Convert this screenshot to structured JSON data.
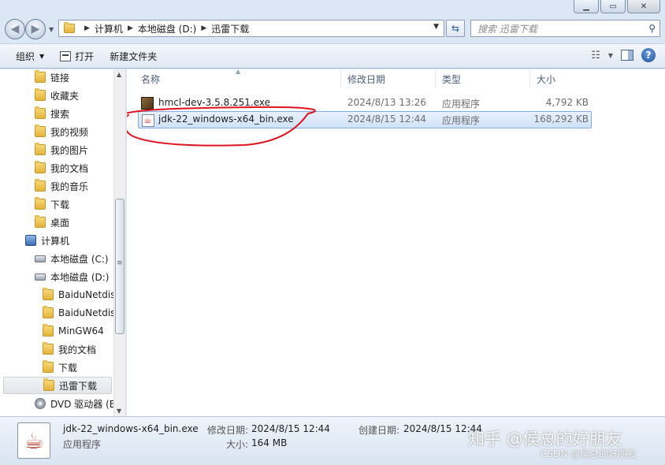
{
  "window": {
    "controls": {
      "minimize": "▁",
      "maximize": "▭",
      "close": "✕"
    }
  },
  "address": {
    "crumbs": [
      "计算机",
      "本地磁盘 (D:)",
      "迅雷下载"
    ],
    "search_placeholder": "搜索 迅雷下载"
  },
  "toolbar": {
    "organize": "组织",
    "open": "打开",
    "new_folder": "新建文件夹"
  },
  "nav": {
    "items": [
      {
        "label": "链接",
        "icon": "folder-icon",
        "indent": 1
      },
      {
        "label": "收藏夹",
        "icon": "folder-icon",
        "indent": 1
      },
      {
        "label": "搜索",
        "icon": "folder-icon",
        "indent": 1
      },
      {
        "label": "我的视频",
        "icon": "folder-icon",
        "indent": 1
      },
      {
        "label": "我的图片",
        "icon": "folder-icon",
        "indent": 1
      },
      {
        "label": "我的文档",
        "icon": "folder-icon",
        "indent": 1
      },
      {
        "label": "我的音乐",
        "icon": "folder-icon",
        "indent": 1
      },
      {
        "label": "下载",
        "icon": "folder-icon",
        "indent": 1
      },
      {
        "label": "桌面",
        "icon": "folder-icon",
        "indent": 1
      },
      {
        "label": "计算机",
        "icon": "computer-icon",
        "indent": 0
      },
      {
        "label": "本地磁盘 (C:)",
        "icon": "drive-icon",
        "indent": 1
      },
      {
        "label": "本地磁盘 (D:)",
        "icon": "drive-icon",
        "indent": 1
      },
      {
        "label": "BaiduNetdis",
        "icon": "folder-icon",
        "indent": 2
      },
      {
        "label": "BaiduNetdis",
        "icon": "folder-icon",
        "indent": 2
      },
      {
        "label": "MinGW64",
        "icon": "folder-icon",
        "indent": 2
      },
      {
        "label": "我的文档",
        "icon": "folder-icon",
        "indent": 2
      },
      {
        "label": "下载",
        "icon": "folder-icon",
        "indent": 2
      },
      {
        "label": "迅雷下载",
        "icon": "folder-icon",
        "indent": 2,
        "selected": true
      },
      {
        "label": "DVD 驱动器 (E",
        "icon": "dvd-icon",
        "indent": 1
      }
    ]
  },
  "columns": {
    "name": "名称",
    "modified": "修改日期",
    "type": "类型",
    "size": "大小"
  },
  "files": [
    {
      "name": "hmcl-dev-3.5.8.251.exe",
      "modified": "2024/8/13 13:26",
      "type": "应用程序",
      "size": "4,792 KB",
      "icon": "hmcl-icon"
    },
    {
      "name": "jdk-22_windows-x64_bin.exe",
      "modified": "2024/8/15 12:44",
      "type": "应用程序",
      "size": "168,292 KB",
      "icon": "java-icon",
      "selected": true
    }
  ],
  "details": {
    "name": "jdk-22_windows-x64_bin.exe",
    "kind": "应用程序",
    "modified_label": "修改日期:",
    "modified": "2024/8/15 12:44",
    "created_label": "创建日期:",
    "created": "2024/8/15 12:44",
    "size_label": "大小:",
    "size": "164 MB"
  },
  "watermark": {
    "zhihu": "知乎 @侯总的好朋友",
    "csdn": "CSDN @侯总的好朋友"
  },
  "colors": {
    "annotation": "#e0141e",
    "selection": "#cfe2f7"
  }
}
